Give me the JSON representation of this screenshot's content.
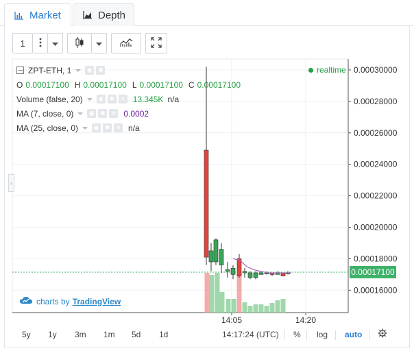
{
  "tabs": [
    {
      "label": "Market",
      "icon": "bar-chart-icon",
      "active": true
    },
    {
      "label": "Depth",
      "icon": "area-chart-icon",
      "active": false
    }
  ],
  "toolbar": {
    "interval": "1",
    "buttons": [
      "more-vertical-icon",
      "chevron-down-icon",
      "candlestick-icon",
      "chevron-down-icon",
      "indicators-icon",
      "fullscreen-icon"
    ]
  },
  "legend": {
    "symbol": "ZPT-ETH, 1",
    "ohlc": [
      {
        "k": "O",
        "v": "0.00017100"
      },
      {
        "k": "H",
        "v": "0.00017100"
      },
      {
        "k": "L",
        "v": "0.00017100"
      },
      {
        "k": "C",
        "v": "0.00017100"
      }
    ],
    "studies": [
      {
        "name": "Volume (false, 20)",
        "value": "13.345K",
        "extra": "n/a",
        "value_color": "#26a044"
      },
      {
        "name": "MA (7, close, 0)",
        "value": "0.0002",
        "extra": "",
        "value_color": "#6a1b9a"
      },
      {
        "name": "MA (25, close, 0)",
        "value": "",
        "extra": "n/a",
        "value_color": "#333333"
      }
    ]
  },
  "realtime_label": "realtime",
  "price_axis": {
    "ticks": [
      "0.00030000",
      "0.00028000",
      "0.00026000",
      "0.00024000",
      "0.00022000",
      "0.00020000",
      "0.00018000",
      "0.00016000"
    ],
    "current_price": "0.00017100"
  },
  "time_axis": {
    "ticks": [
      "14:05",
      "14:20"
    ]
  },
  "branding": {
    "prefix": "charts by",
    "name": "TradingView"
  },
  "bottom": {
    "ranges": [
      "5y",
      "1y",
      "3m",
      "1m",
      "5d",
      "1d"
    ],
    "time": "14:17:24 (UTC)",
    "percent": "%",
    "log": "log",
    "auto": "auto"
  },
  "colors": {
    "up": "#26a69a",
    "down": "#ef5350",
    "up_candle": "#3aa55a",
    "down_candle": "#e0463c",
    "accent": "#2a7fd0",
    "vol_up": "#8fd19e",
    "vol_down": "#f29c9c",
    "ma": "#b05fc4"
  }
}
